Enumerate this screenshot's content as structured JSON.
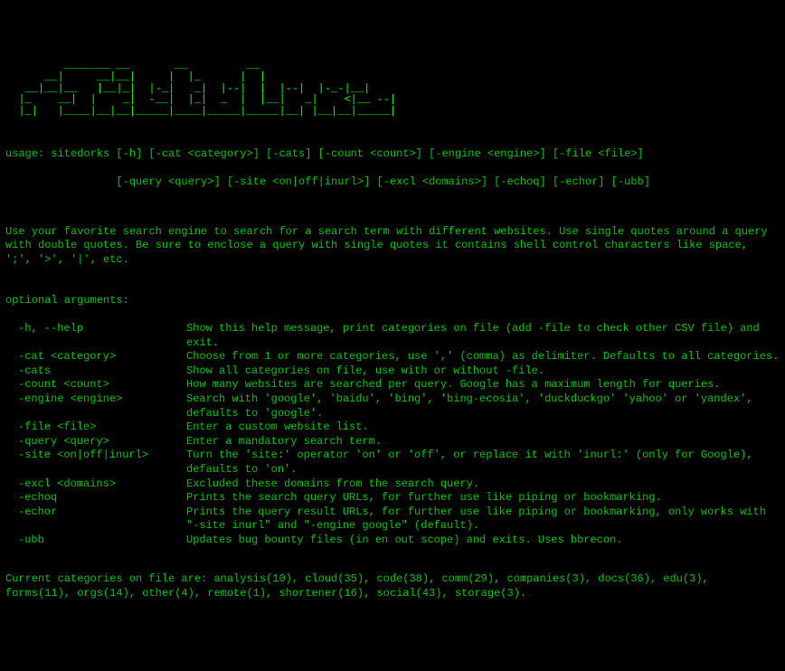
{
  "banner": [
    "         _______ __       __         __",
    "      __|     __|__|     |  |_      |  |",
    "   __|__|__   |__|_|  |-_|   _|  |--|  |  |--|  |-_-|__|",
    "  |_    __|  |    _|  -__|  |_|  _  |  |__|   _|    <|__ --|",
    "  |_|   |____|__|__|_____|____|_____|_____|__| |__|__|_____|"
  ],
  "usage_line1": "usage: sitedorks [-h] [-cat <category>] [-cats] [-count <count>] [-engine <engine>] [-file <file>]",
  "usage_line2": "                 [-query <query>] [-site <on|off|inurl>] [-excl <domains>] [-echoq] [-echor] [-ubb]",
  "description": "Use your favorite search engine to search for a search term with different websites. Use single quotes around a query with double quotes. Be sure to enclose a query with single quotes it contains shell control characters like space, ';', '>', '|', etc.",
  "section_title": "optional arguments:",
  "args": [
    {
      "flag": "-h, --help",
      "desc": "Show this help message, print categories on file (add -file to check other CSV file) and exit."
    },
    {
      "flag": "-cat <category>",
      "desc": "Choose from 1 or more categories, use ',' (comma) as delimiter. Defaults to all categories."
    },
    {
      "flag": "-cats",
      "desc": "Show all categories on file, use with or without -file."
    },
    {
      "flag": "-count <count>",
      "desc": "How many websites are searched per query. Google has a maximum length for queries."
    },
    {
      "flag": "-engine <engine>",
      "desc": "Search with 'google', 'baidu', 'bing', 'bing-ecosia', 'duckduckgo' 'yahoo' or 'yandex', defaults to 'google'."
    },
    {
      "flag": "-file <file>",
      "desc": "Enter a custom website list."
    },
    {
      "flag": "-query <query>",
      "desc": "Enter a mandatory search term."
    },
    {
      "flag": "-site <on|off|inurl>",
      "desc": "Turn the 'site:' operator 'on' or 'off', or replace it with 'inurl:' (only for Google), defaults to 'on'."
    },
    {
      "flag": "-excl <domains>",
      "desc": "Excluded these domains from the search query."
    },
    {
      "flag": "-echoq",
      "desc": "Prints the search query URLs, for further use like piping or bookmarking."
    },
    {
      "flag": "-echor",
      "desc": "Prints the query result URLs, for further use like piping or bookmarking, only works with \"-site inurl\" and \"-engine google\" (default)."
    },
    {
      "flag": "-ubb",
      "desc": "Updates bug bounty files (in en out scope) and exits. Uses bbrecon."
    }
  ],
  "categories_line": "Current categories on file are: analysis(10), cloud(35), code(38), comm(29), companies(3), docs(36), edu(3), forms(11), orgs(14), other(4), remote(1), shortener(16), social(43), storage(3)."
}
